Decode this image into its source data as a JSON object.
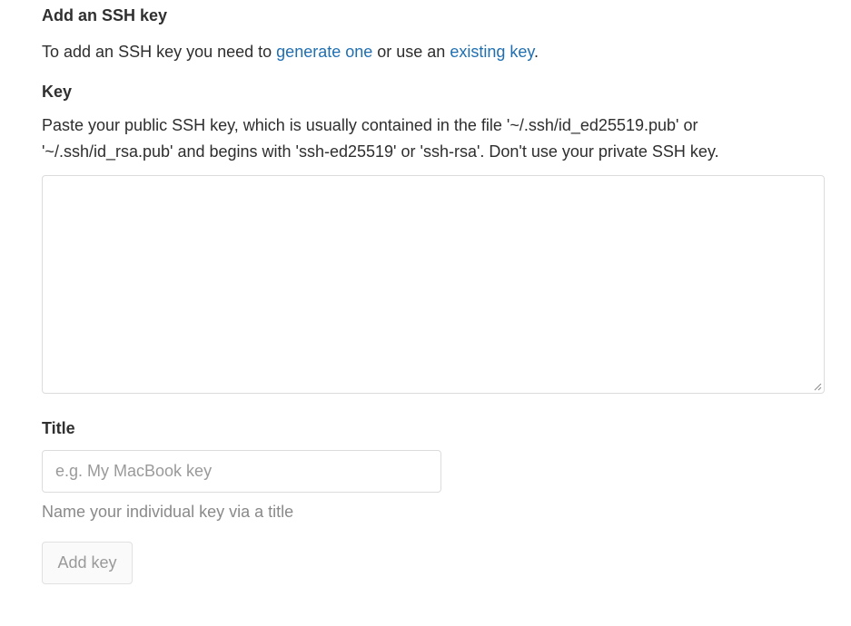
{
  "section": {
    "heading": "Add an SSH key",
    "intro_prefix": "To add an SSH key you need to ",
    "generate_link": "generate one",
    "intro_middle": " or use an ",
    "existing_link": "existing key",
    "intro_suffix": "."
  },
  "key_field": {
    "label": "Key",
    "help_line1": "Paste your public SSH key, which is usually contained in the file '~/.ssh/id_ed25519.pub' or",
    "help_line2": "'~/.ssh/id_rsa.pub' and begins with 'ssh-ed25519' or 'ssh-rsa'. Don't use your private SSH key.",
    "value": ""
  },
  "title_field": {
    "label": "Title",
    "placeholder": "e.g. My MacBook key",
    "value": "",
    "help": "Name your individual key via a title"
  },
  "actions": {
    "add_key_label": "Add key"
  }
}
